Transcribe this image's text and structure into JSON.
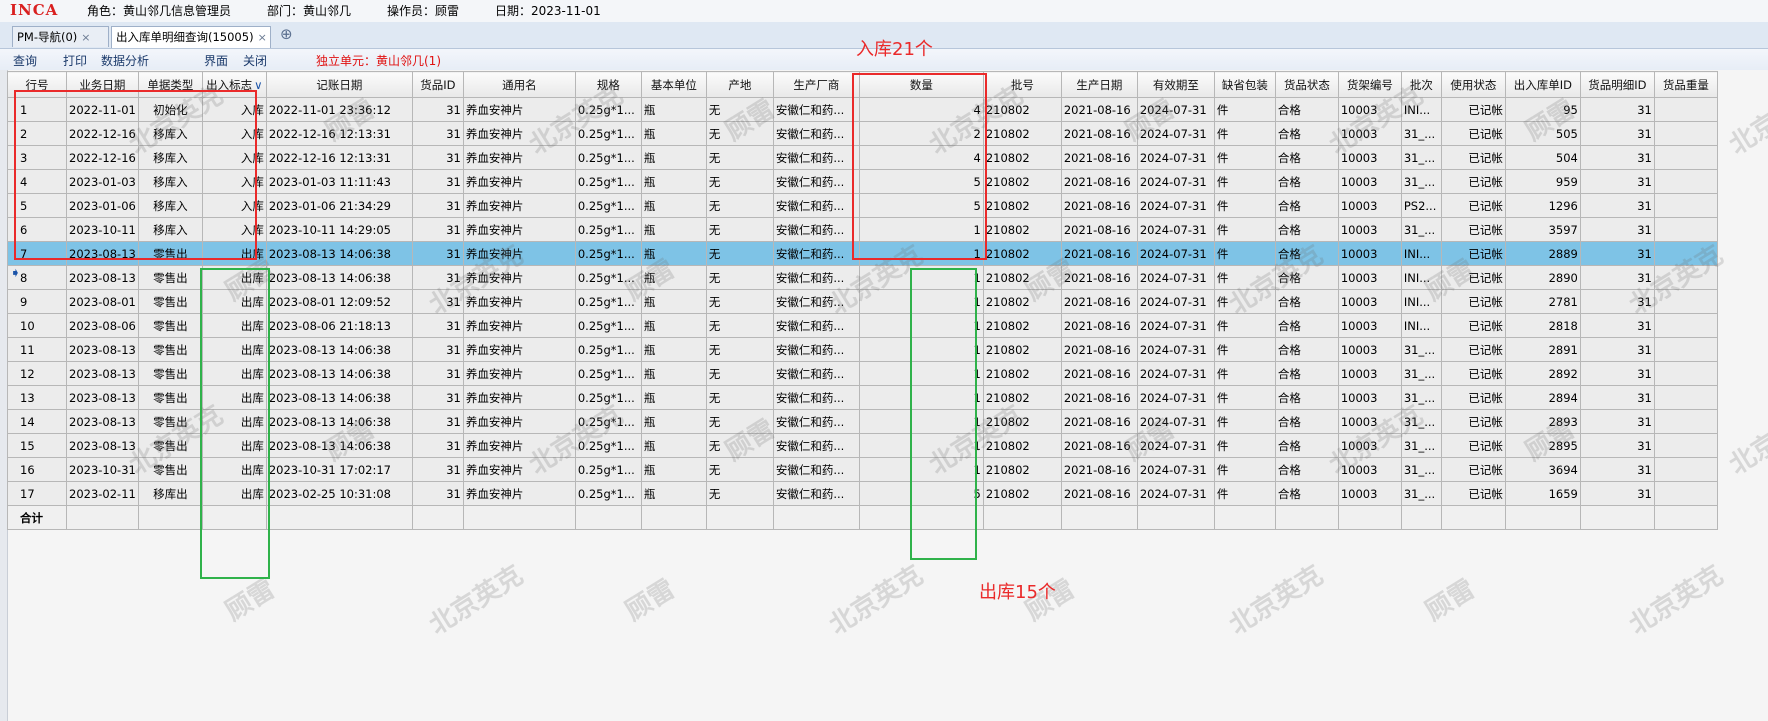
{
  "header": {
    "logo": "INCA",
    "role": "角色：黄山邻几信息管理员",
    "dept": "部门：黄山邻几",
    "operator": "操作员：顾雷",
    "date": "日期：2023-11-01"
  },
  "tabs": [
    {
      "label": "PM-导航(0)",
      "close": "×"
    },
    {
      "label": "出入库单明细查询(15005)",
      "close": "×"
    }
  ],
  "tab_add": "⊕",
  "menu": [
    "查询",
    "打印",
    "数据分析",
    "界面",
    "关闭"
  ],
  "unit_label": "独立单元：黄山邻几(1)",
  "columns": [
    "行号",
    "业务日期",
    "单据类型",
    "出入标志",
    "记账日期",
    "货品ID",
    "通用名",
    "规格",
    "基本单位",
    "产地",
    "生产厂商",
    "数量",
    "批号",
    "生产日期",
    "有效期至",
    "缺省包装",
    "货品状态",
    "货架编号",
    "批次",
    "使用状态",
    "出入库单ID",
    "货品明细ID",
    "货品重量"
  ],
  "rows": [
    [
      "1",
      "2022-11-01",
      "初始化",
      "入库",
      "2022-11-01 23:36:12",
      "31",
      "养血安神片",
      "0.25g*1...",
      "瓶",
      "无",
      "安徽仁和药...",
      "4",
      "210802",
      "2021-08-16",
      "2024-07-31",
      "件",
      "合格",
      "10003",
      "INI...",
      "已记帐",
      "95",
      "31",
      ""
    ],
    [
      "2",
      "2022-12-16",
      "移库入",
      "入库",
      "2022-12-16 12:13:31",
      "31",
      "养血安神片",
      "0.25g*1...",
      "瓶",
      "无",
      "安徽仁和药...",
      "2",
      "210802",
      "2021-08-16",
      "2024-07-31",
      "件",
      "合格",
      "10003",
      "31_...",
      "已记帐",
      "505",
      "31",
      ""
    ],
    [
      "3",
      "2022-12-16",
      "移库入",
      "入库",
      "2022-12-16 12:13:31",
      "31",
      "养血安神片",
      "0.25g*1...",
      "瓶",
      "无",
      "安徽仁和药...",
      "4",
      "210802",
      "2021-08-16",
      "2024-07-31",
      "件",
      "合格",
      "10003",
      "31_...",
      "已记帐",
      "504",
      "31",
      ""
    ],
    [
      "4",
      "2023-01-03",
      "移库入",
      "入库",
      "2023-01-03 11:11:43",
      "31",
      "养血安神片",
      "0.25g*1...",
      "瓶",
      "无",
      "安徽仁和药...",
      "5",
      "210802",
      "2021-08-16",
      "2024-07-31",
      "件",
      "合格",
      "10003",
      "31_...",
      "已记帐",
      "959",
      "31",
      ""
    ],
    [
      "5",
      "2023-01-06",
      "移库入",
      "入库",
      "2023-01-06 21:34:29",
      "31",
      "养血安神片",
      "0.25g*1...",
      "瓶",
      "无",
      "安徽仁和药...",
      "5",
      "210802",
      "2021-08-16",
      "2024-07-31",
      "件",
      "合格",
      "10003",
      "PS2...",
      "已记帐",
      "1296",
      "31",
      ""
    ],
    [
      "6",
      "2023-10-11",
      "移库入",
      "入库",
      "2023-10-11 14:29:05",
      "31",
      "养血安神片",
      "0.25g*1...",
      "瓶",
      "无",
      "安徽仁和药...",
      "1",
      "210802",
      "2021-08-16",
      "2024-07-31",
      "件",
      "合格",
      "10003",
      "31_...",
      "已记帐",
      "3597",
      "31",
      ""
    ],
    [
      "7",
      "2023-08-13",
      "零售出",
      "出库",
      "2023-08-13 14:06:38",
      "31",
      "养血安神片",
      "0.25g*1...",
      "瓶",
      "无",
      "安徽仁和药...",
      "1",
      "210802",
      "2021-08-16",
      "2024-07-31",
      "件",
      "合格",
      "10003",
      "INI...",
      "已记帐",
      "2889",
      "31",
      ""
    ],
    [
      "8",
      "2023-08-13",
      "零售出",
      "出库",
      "2023-08-13 14:06:38",
      "31",
      "养血安神片",
      "0.25g*1...",
      "瓶",
      "无",
      "安徽仁和药...",
      "1",
      "210802",
      "2021-08-16",
      "2024-07-31",
      "件",
      "合格",
      "10003",
      "INI...",
      "已记帐",
      "2890",
      "31",
      ""
    ],
    [
      "9",
      "2023-08-01",
      "零售出",
      "出库",
      "2023-08-01 12:09:52",
      "31",
      "养血安神片",
      "0.25g*1...",
      "瓶",
      "无",
      "安徽仁和药...",
      "1",
      "210802",
      "2021-08-16",
      "2024-07-31",
      "件",
      "合格",
      "10003",
      "INI...",
      "已记帐",
      "2781",
      "31",
      ""
    ],
    [
      "10",
      "2023-08-06",
      "零售出",
      "出库",
      "2023-08-06 21:18:13",
      "31",
      "养血安神片",
      "0.25g*1...",
      "瓶",
      "无",
      "安徽仁和药...",
      "1",
      "210802",
      "2021-08-16",
      "2024-07-31",
      "件",
      "合格",
      "10003",
      "INI...",
      "已记帐",
      "2818",
      "31",
      ""
    ],
    [
      "11",
      "2023-08-13",
      "零售出",
      "出库",
      "2023-08-13 14:06:38",
      "31",
      "养血安神片",
      "0.25g*1...",
      "瓶",
      "无",
      "安徽仁和药...",
      "1",
      "210802",
      "2021-08-16",
      "2024-07-31",
      "件",
      "合格",
      "10003",
      "31_...",
      "已记帐",
      "2891",
      "31",
      ""
    ],
    [
      "12",
      "2023-08-13",
      "零售出",
      "出库",
      "2023-08-13 14:06:38",
      "31",
      "养血安神片",
      "0.25g*1...",
      "瓶",
      "无",
      "安徽仁和药...",
      "1",
      "210802",
      "2021-08-16",
      "2024-07-31",
      "件",
      "合格",
      "10003",
      "31_...",
      "已记帐",
      "2892",
      "31",
      ""
    ],
    [
      "13",
      "2023-08-13",
      "零售出",
      "出库",
      "2023-08-13 14:06:38",
      "31",
      "养血安神片",
      "0.25g*1...",
      "瓶",
      "无",
      "安徽仁和药...",
      "1",
      "210802",
      "2021-08-16",
      "2024-07-31",
      "件",
      "合格",
      "10003",
      "31_...",
      "已记帐",
      "2894",
      "31",
      ""
    ],
    [
      "14",
      "2023-08-13",
      "零售出",
      "出库",
      "2023-08-13 14:06:38",
      "31",
      "养血安神片",
      "0.25g*1...",
      "瓶",
      "无",
      "安徽仁和药...",
      "1",
      "210802",
      "2021-08-16",
      "2024-07-31",
      "件",
      "合格",
      "10003",
      "31_...",
      "已记帐",
      "2893",
      "31",
      ""
    ],
    [
      "15",
      "2023-08-13",
      "零售出",
      "出库",
      "2023-08-13 14:06:38",
      "31",
      "养血安神片",
      "0.25g*1...",
      "瓶",
      "无",
      "安徽仁和药...",
      "1",
      "210802",
      "2021-08-16",
      "2024-07-31",
      "件",
      "合格",
      "10003",
      "31_...",
      "已记帐",
      "2895",
      "31",
      ""
    ],
    [
      "16",
      "2023-10-31",
      "零售出",
      "出库",
      "2023-10-31 17:02:17",
      "31",
      "养血安神片",
      "0.25g*1...",
      "瓶",
      "无",
      "安徽仁和药...",
      "1",
      "210802",
      "2021-08-16",
      "2024-07-31",
      "件",
      "合格",
      "10003",
      "31_...",
      "已记帐",
      "3694",
      "31",
      ""
    ],
    [
      "17",
      "2023-02-11",
      "移库出",
      "出库",
      "2023-02-25 10:31:08",
      "31",
      "养血安神片",
      "0.25g*1...",
      "瓶",
      "无",
      "安徽仁和药...",
      "5",
      "210802",
      "2021-08-16",
      "2024-07-31",
      "件",
      "合格",
      "10003",
      "31_...",
      "已记帐",
      "1659",
      "31",
      ""
    ]
  ],
  "selected_row": 7,
  "total_label": "合计",
  "watermark": [
    "北京英克",
    "顾雷"
  ],
  "annotations": {
    "in_label": "入库21个",
    "out_label": "出库15个"
  },
  "colors": {
    "logo": "#d92020",
    "selected_row": "#7ec3e6",
    "annotation_red": "#ea2a2a",
    "annotation_green": "#2fb24a"
  }
}
